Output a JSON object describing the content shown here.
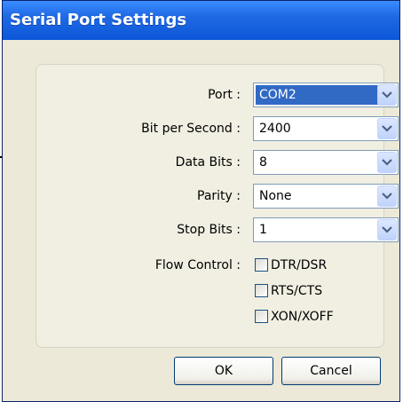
{
  "window": {
    "title": "Serial Port Settings"
  },
  "fields": [
    {
      "label": "Port :",
      "value": "COM2",
      "selected": true
    },
    {
      "label": "Bit per Second :",
      "value": "2400",
      "selected": false
    },
    {
      "label": "Data Bits :",
      "value": "8",
      "selected": false
    },
    {
      "label": "Parity :",
      "value": "None",
      "selected": false
    },
    {
      "label": "Stop Bits :",
      "value": "1",
      "selected": false
    }
  ],
  "flow_control": {
    "label": "Flow Control :",
    "options": [
      {
        "label": "DTR/DSR",
        "checked": false
      },
      {
        "label": "RTS/CTS",
        "checked": false
      },
      {
        "label": "XON/XOFF",
        "checked": false
      }
    ]
  },
  "buttons": {
    "ok": "OK",
    "cancel": "Cancel"
  },
  "colors": {
    "title_bar": "#0b57d8",
    "selection": "#316ac5",
    "dialog_bg": "#ece9d8"
  }
}
